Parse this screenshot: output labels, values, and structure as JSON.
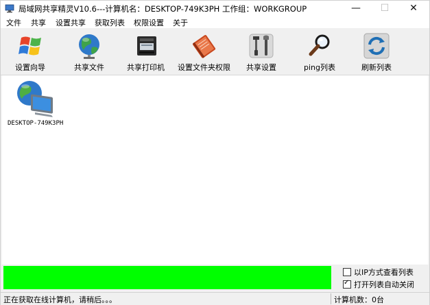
{
  "window": {
    "title": "局域网共享精灵V10.6---计算机名：DESKTOP-749K3PH  工作组：WORKGROUP",
    "controls": {
      "minimize": "—",
      "maximize": "☐",
      "close": "✕"
    }
  },
  "menu": [
    "文件",
    "共享",
    "设置共享",
    "获取列表",
    "权限设置",
    "关于"
  ],
  "toolbar": [
    {
      "label": "设置向导",
      "icon": "windows-logo-icon"
    },
    {
      "label": "共享文件",
      "icon": "globe-icon"
    },
    {
      "label": "共享打印机",
      "icon": "printer-icon"
    },
    {
      "label": "设置文件夹权限",
      "icon": "notebook-icon"
    },
    {
      "label": "共享设置",
      "icon": "tools-icon"
    },
    {
      "label": "ping列表",
      "icon": "magnifier-icon"
    },
    {
      "label": "刷新列表",
      "icon": "refresh-icon"
    }
  ],
  "computers": [
    {
      "name": "DESKTOP-749K3PH",
      "icon": "network-computer-icon"
    }
  ],
  "progress": {
    "value": 1.0,
    "color": "#00ff00"
  },
  "options": [
    {
      "label": "以IP方式查看列表",
      "checked": false
    },
    {
      "label": "打开列表自动关闭",
      "checked": true
    }
  ],
  "status": {
    "left": "正在获取在线计算机，请稍后。。。",
    "right": "计算机数：0台"
  }
}
